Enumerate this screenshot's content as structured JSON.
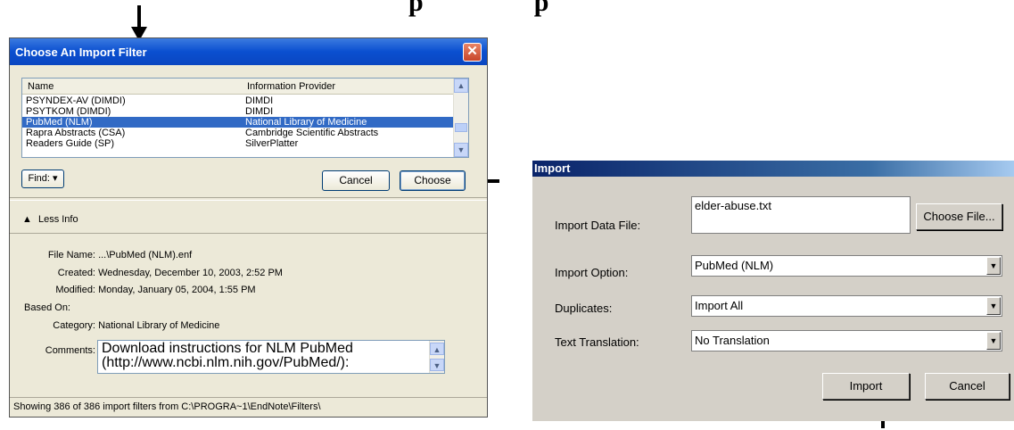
{
  "heading_fragment": [
    "p",
    "p"
  ],
  "filter_dialog": {
    "title": "Choose An Import Filter",
    "close_glyph": "✕",
    "columns": [
      "Name",
      "Information Provider"
    ],
    "rows": [
      {
        "name": "PSYNDEX-AV (DIMDI)",
        "provider": "DIMDI",
        "selected": false
      },
      {
        "name": "PSYTKOM (DIMDI)",
        "provider": "DIMDI",
        "selected": false
      },
      {
        "name": "PubMed (NLM)",
        "provider": "National Library of Medicine",
        "selected": true
      },
      {
        "name": "Rapra Abstracts (CSA)",
        "provider": "Cambridge Scientific Abstracts",
        "selected": false
      },
      {
        "name": "Readers Guide (SP)",
        "provider": "SilverPlatter",
        "selected": false
      }
    ],
    "find_label": "Find: ▾",
    "cancel_label": "Cancel",
    "choose_label": "Choose",
    "less_info_label": "Less Info",
    "info": {
      "file_name_label": "File Name:",
      "file_name": "...\\PubMed (NLM).enf",
      "created_label": "Created:",
      "created": "Wednesday, December 10, 2003, 2:52 PM",
      "modified_label": "Modified:",
      "modified": "Monday, January 05, 2004, 1:55 PM",
      "based_on_label": "Based On:",
      "based_on": "",
      "category_label": "Category:",
      "category": "National Library of Medicine",
      "comments_label": "Comments:",
      "comments_line1": "Download instructions for NLM PubMed",
      "comments_line2": "(http://www.ncbi.nlm.nih.gov/PubMed/):"
    },
    "status": "Showing 386 of 386 import filters from C:\\PROGRA~1\\EndNote\\Filters\\"
  },
  "import_dialog": {
    "title": "Import",
    "data_file_label": "Import Data File:",
    "data_file_value": "elder-abuse.txt",
    "choose_file_label": "Choose File...",
    "option_label": "Import Option:",
    "option_value": "PubMed (NLM)",
    "duplicates_label": "Duplicates:",
    "duplicates_value": "Import All",
    "translation_label": "Text Translation:",
    "translation_value": "No Translation",
    "import_label": "Import",
    "cancel_label": "Cancel"
  },
  "colors": {
    "selection": "#316ac5",
    "xp_title": "#0a4fd0",
    "classic_title": "#0a246a"
  }
}
